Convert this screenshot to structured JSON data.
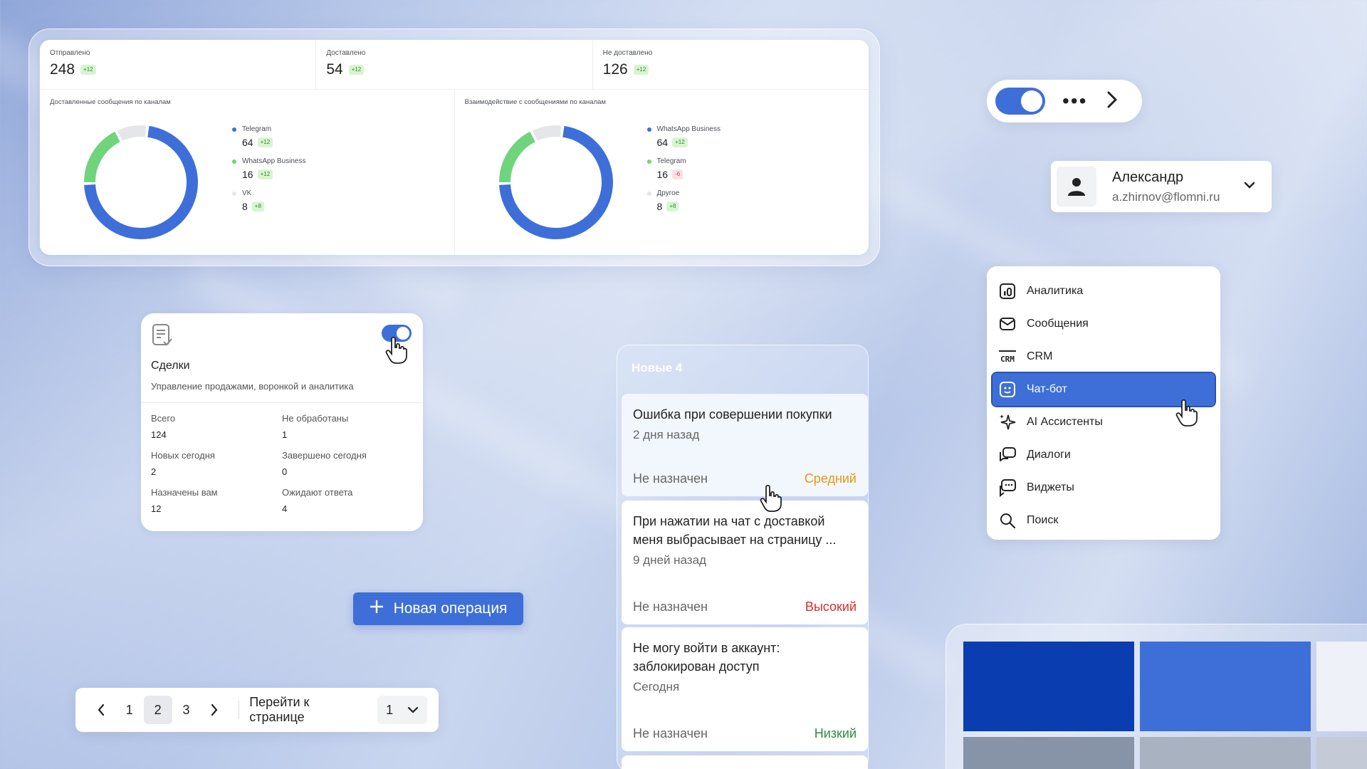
{
  "stats": {
    "cards": [
      {
        "label": "Отправлено",
        "value": "248",
        "delta": "+12"
      },
      {
        "label": "Доставлено",
        "value": "54",
        "delta": "+12"
      },
      {
        "label": "Не доставлено",
        "value": "126",
        "delta": "+12"
      }
    ],
    "chart_data": [
      {
        "type": "pie",
        "title": "Доставленные сообщения по каналам",
        "categories": [
          "Telegram",
          "WhatsApp Business",
          "VK"
        ],
        "values": [
          64,
          16,
          8
        ],
        "deltas": [
          "+12",
          "+12",
          "+8"
        ],
        "colors": [
          "#3e6fd8",
          "#6fd47c",
          "#e4e6ea"
        ],
        "donut": true
      },
      {
        "type": "pie",
        "title": "Взаимодействие с сообщениями по каналам",
        "categories": [
          "WhatsApp Business",
          "Telegram",
          "Другое"
        ],
        "values": [
          64,
          16,
          8
        ],
        "deltas": [
          "+12",
          "-6",
          "+8"
        ],
        "colors": [
          "#3e6fd8",
          "#6fd47c",
          "#e4e6ea"
        ],
        "donut": true
      }
    ]
  },
  "user": {
    "name": "Александр",
    "email": "a.zhirnov@flomni.ru"
  },
  "menu": {
    "items": [
      {
        "label": "Аналитика",
        "icon": "analytics-icon"
      },
      {
        "label": "Сообщения",
        "icon": "messages-icon"
      },
      {
        "label": "CRM",
        "icon": "crm-icon"
      },
      {
        "label": "Чат-бот",
        "icon": "chatbot-icon",
        "active": true
      },
      {
        "label": "AI Ассистенты",
        "icon": "sparkle-icon"
      },
      {
        "label": "Диалоги",
        "icon": "dialogs-icon"
      },
      {
        "label": "Виджеты",
        "icon": "widgets-icon"
      },
      {
        "label": "Поиск",
        "icon": "search-icon"
      }
    ]
  },
  "deals": {
    "title": "Сделки",
    "subtitle": "Управление продажами, воронкой и аналитика",
    "enabled": true,
    "metrics": [
      {
        "label": "Всего",
        "value": "124"
      },
      {
        "label": "Не обработаны",
        "value": "1"
      },
      {
        "label": "Новых сегодня",
        "value": "2"
      },
      {
        "label": "Завершено сегодня",
        "value": "0"
      },
      {
        "label": "Назначены вам",
        "value": "12"
      },
      {
        "label": "Ожидают ответа",
        "value": "4"
      }
    ]
  },
  "kanban": {
    "column_title": "Новые 4",
    "tickets": [
      {
        "title": "Ошибка при совершении покупки",
        "time": "2 дня назад",
        "assignee": "Не назначен",
        "priority": "Средний",
        "priority_color": "#e39a12"
      },
      {
        "title": "При нажатии на чат с доставкой меня выбрасывает на страницу ...",
        "time": "9 дней назад",
        "assignee": "Не назначен",
        "priority": "Высокий",
        "priority_color": "#d92d2d"
      },
      {
        "title": "Не могу войти в аккаунт: заблокирован доступ",
        "time": "Сегодня",
        "assignee": "Не назначен",
        "priority": "Низкий",
        "priority_color": "#2e8b3a"
      }
    ]
  },
  "new_operation": {
    "label": "Новая операция"
  },
  "pagination": {
    "pages": [
      "1",
      "2",
      "3"
    ],
    "current": "2",
    "goto_label": "Перейти к странице",
    "goto_value": "1"
  },
  "colors": {
    "accent": "#3e6fd8",
    "swatch_dark": "#0a3eb0",
    "swatch_blue": "#3e6fd8",
    "swatch_grey": "#8793a6"
  }
}
